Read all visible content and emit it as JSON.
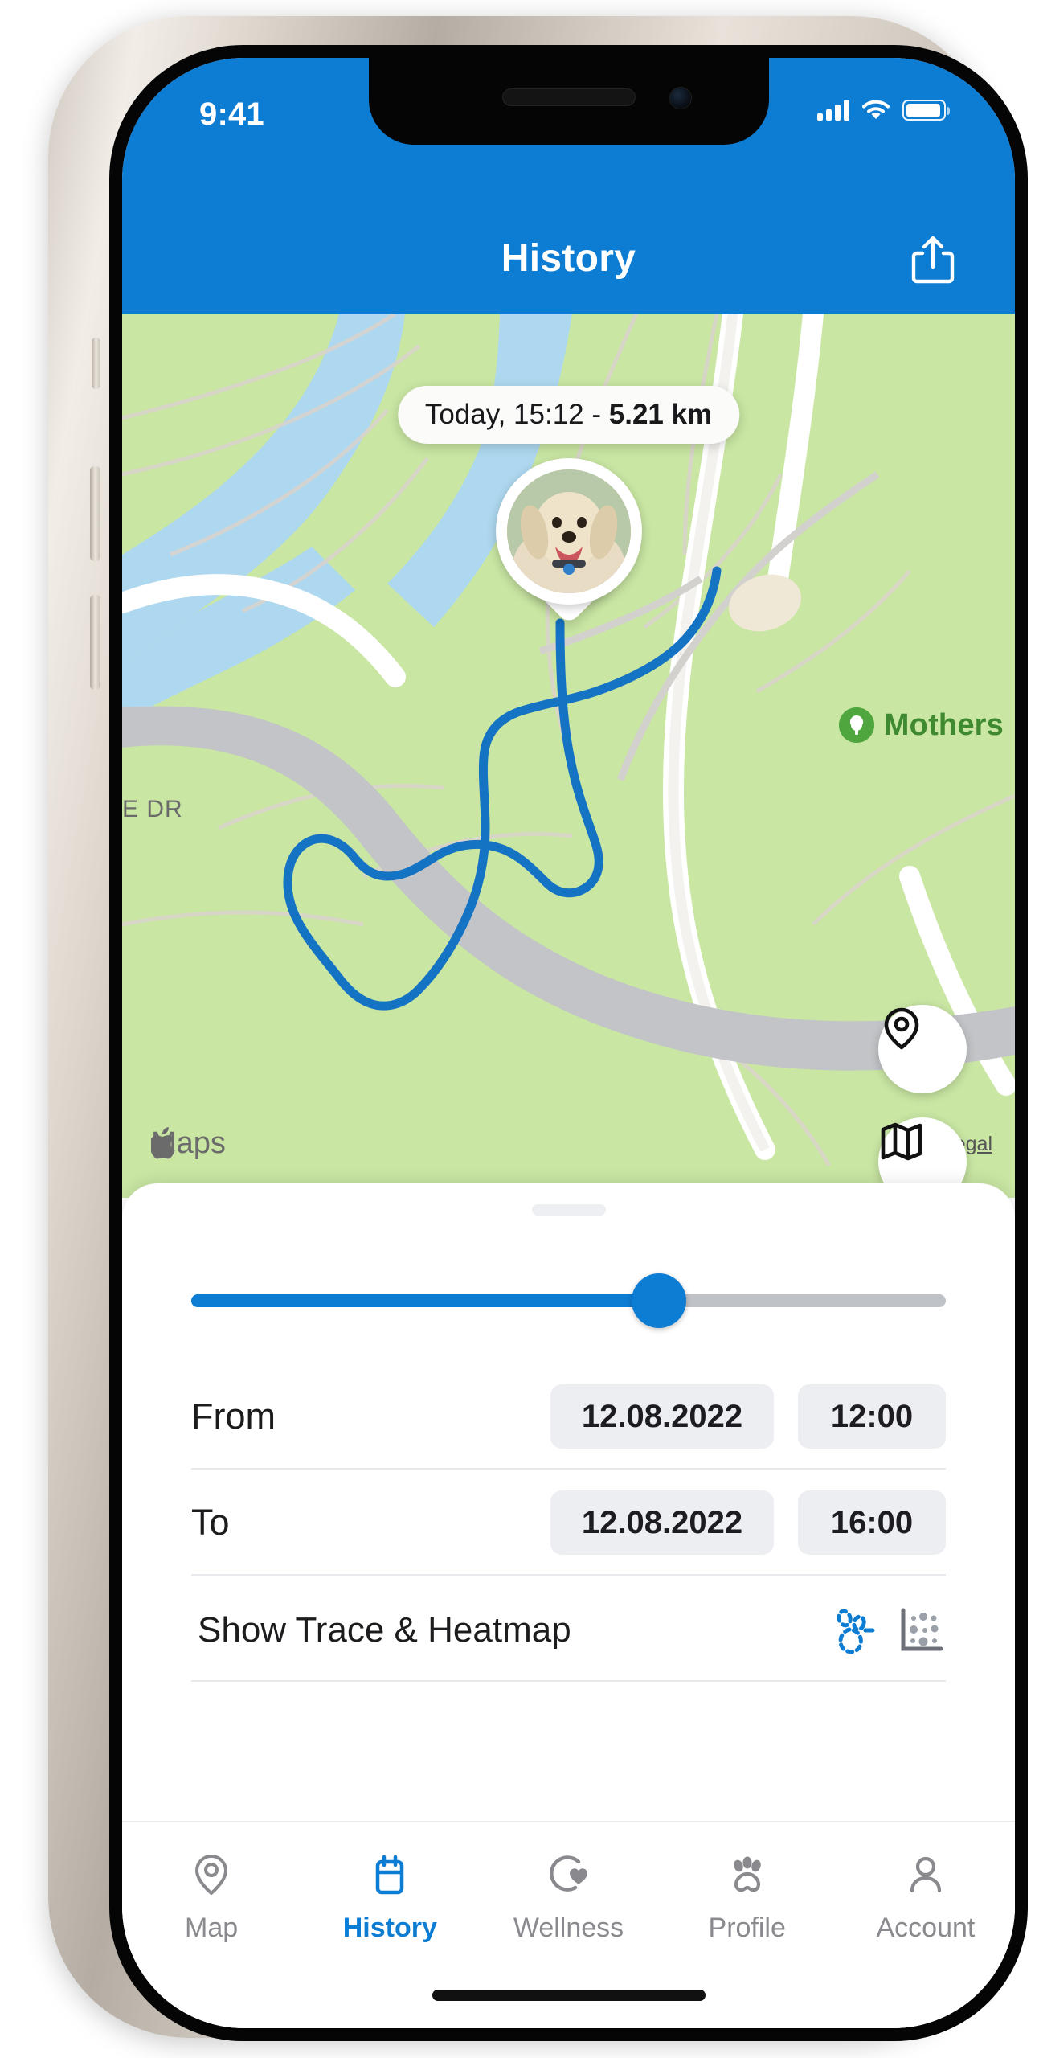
{
  "status_bar": {
    "time": "9:41",
    "signal_icon": "cellular-signal-icon",
    "wifi_icon": "wifi-icon",
    "battery_icon": "battery-icon"
  },
  "header": {
    "title": "History",
    "share_icon": "share-icon",
    "background_color": "#0d7dd4"
  },
  "map": {
    "callout_prefix": "Today, 15:12 - ",
    "callout_distance": "5.21 km",
    "pet_avatar": "dog-avatar",
    "poi_label": "Mothers",
    "poi_icon": "park-tree-icon",
    "street_label": "E DR",
    "locate_button_icon": "location-pin-icon",
    "layers_button_icon": "map-layers-icon",
    "attribution": "Maps",
    "attribution_logo": "apple-logo-icon",
    "legal_link": "Legal",
    "track_color": "#1573c4",
    "park_color": "#c9e6a3",
    "water_color": "#aed8ef",
    "road_color": "#c2c4c7"
  },
  "sheet": {
    "grabber": "sheet-grabber",
    "slider": {
      "value_percent": 62,
      "fill_color": "#0d7dd4",
      "track_color": "#bfc2c7"
    },
    "rows": [
      {
        "label": "From",
        "date": "12.08.2022",
        "time": "12:00"
      },
      {
        "label": "To",
        "date": "12.08.2022",
        "time": "16:00"
      }
    ],
    "trace_row": {
      "label": "Show Trace & Heatmap",
      "trace_icon": "trace-paw-icon",
      "trace_icon_color": "#0d7dd4",
      "heatmap_icon": "heatmap-chart-icon",
      "heatmap_icon_color": "#6d7078"
    }
  },
  "tab_bar": {
    "active_color": "#0d7dd4",
    "inactive_color": "#8a8a8e",
    "items": [
      {
        "label": "Map",
        "icon": "map-pin-icon",
        "active": false
      },
      {
        "label": "History",
        "icon": "calendar-icon",
        "active": true
      },
      {
        "label": "Wellness",
        "icon": "heart-activity-icon",
        "active": false
      },
      {
        "label": "Profile",
        "icon": "paw-icon",
        "active": false
      },
      {
        "label": "Account",
        "icon": "person-icon",
        "active": false
      }
    ]
  }
}
